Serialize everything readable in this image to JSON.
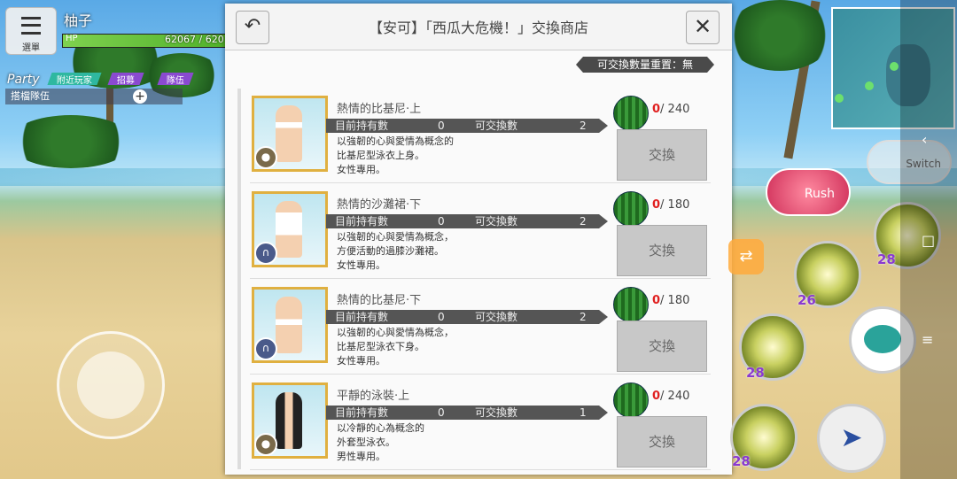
{
  "hud": {
    "menu_label": "選單",
    "player_name": "柚子",
    "hp_label": "HP",
    "hp_value": "62067 / 620",
    "party_title": "Party",
    "party_tabs": [
      "附近玩家",
      "招募",
      "隊伍"
    ],
    "party_row": "搭檔隊伍"
  },
  "shop": {
    "title": "【安可】「西瓜大危機！」交換商店",
    "reset_text": "可交換數量重置：無",
    "owned_label": "目前持有數",
    "exch_label": "可交換數",
    "button_label": "交換",
    "items": [
      {
        "name": "熱情的比基尼·上",
        "owned": "0",
        "exchangeable": "2",
        "cost_have": "0",
        "cost_need": "/ 240",
        "desc": [
          "以強韌的心與愛情為概念的",
          "比基尼型泳衣上身。",
          "女性專用。"
        ]
      },
      {
        "name": "熱情的沙灘裙·下",
        "owned": "0",
        "exchangeable": "2",
        "cost_have": "0",
        "cost_need": "/ 180",
        "desc": [
          "以強韌的心與愛情為概念，",
          "方便活動的過膝沙灘裙。",
          "女性專用。"
        ]
      },
      {
        "name": "熱情的比基尼·下",
        "owned": "0",
        "exchangeable": "2",
        "cost_have": "0",
        "cost_need": "/ 180",
        "desc": [
          "以強韌的心與愛情為概念，",
          "比基尼型泳衣下身。",
          "女性專用。"
        ]
      },
      {
        "name": "平靜的泳裝·上",
        "owned": "0",
        "exchangeable": "1",
        "cost_have": "0",
        "cost_need": "/ 240",
        "desc": [
          "以冷靜的心為概念的",
          "外套型泳衣。",
          "男性專用。"
        ]
      }
    ]
  },
  "right_hud": {
    "rush_label": "Rush",
    "switch_label": "Switch",
    "skill_levels": [
      "28",
      "26",
      "28",
      "28"
    ]
  },
  "colors": {
    "accent": "#e02020",
    "panel_bg": "#fafafa",
    "strip": "#555555"
  }
}
